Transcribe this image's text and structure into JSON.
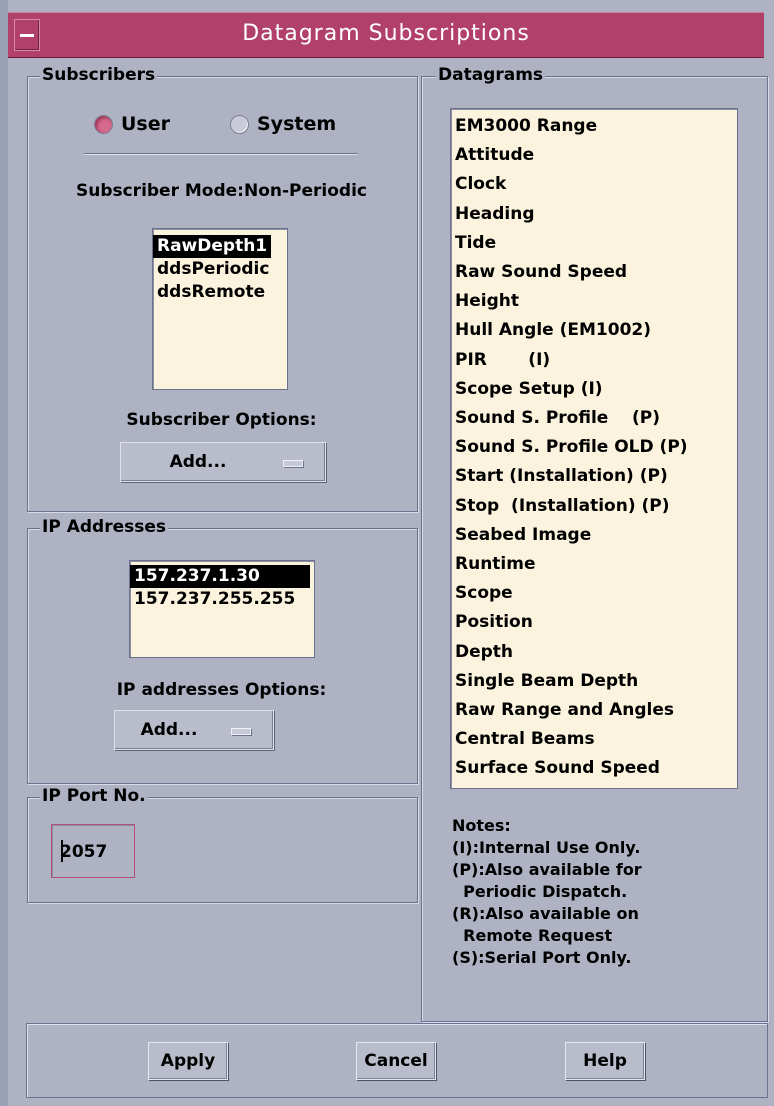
{
  "window": {
    "title": "Datagram Subscriptions"
  },
  "subscribers": {
    "group_label": "Subscribers",
    "radios": [
      {
        "label": "User",
        "selected": true
      },
      {
        "label": "System",
        "selected": false
      }
    ],
    "mode_text": "Subscriber Mode:Non-Periodic",
    "list": [
      "RawDepth1",
      "ddsPeriodic",
      "ddsRemote"
    ],
    "selected_index": 0,
    "options_label": "Subscriber Options:",
    "options_button": "Add..."
  },
  "ip_addresses": {
    "group_label": "IP Addresses",
    "list": [
      "157.237.1.30",
      "157.237.255.255"
    ],
    "selected_index": 0,
    "options_label": "IP addresses Options:",
    "options_button": "Add..."
  },
  "ip_port": {
    "group_label": "IP Port No.",
    "value": "2057"
  },
  "datagrams": {
    "group_label": "Datagrams",
    "list": [
      "EM3000 Range",
      "Attitude",
      "Clock",
      "Heading",
      "Tide",
      "Raw Sound Speed",
      "Height",
      "Hull Angle (EM1002)",
      "PIR       (I)",
      "Scope Setup (I)",
      "Sound S. Profile    (P)",
      "Sound S. Profile OLD (P)",
      "Start (Installation) (P)",
      "Stop  (Installation) (P)",
      "Seabed Image",
      "Runtime",
      "Scope",
      "Position",
      "Depth",
      "Single Beam Depth",
      "Raw Range and Angles",
      "Central Beams",
      "Surface Sound Speed"
    ],
    "notes": [
      "Notes:",
      "(I):Internal Use Only.",
      "(P):Also available for",
      "  Periodic Dispatch.",
      "(R):Also available on",
      "  Remote Request",
      "(S):Serial Port Only."
    ]
  },
  "buttons": {
    "apply": "Apply",
    "cancel": "Cancel",
    "help": "Help"
  },
  "colors": {
    "titlebar": "#b1416a",
    "background": "#aeb2c3",
    "list_bg": "#fbf3dd"
  }
}
